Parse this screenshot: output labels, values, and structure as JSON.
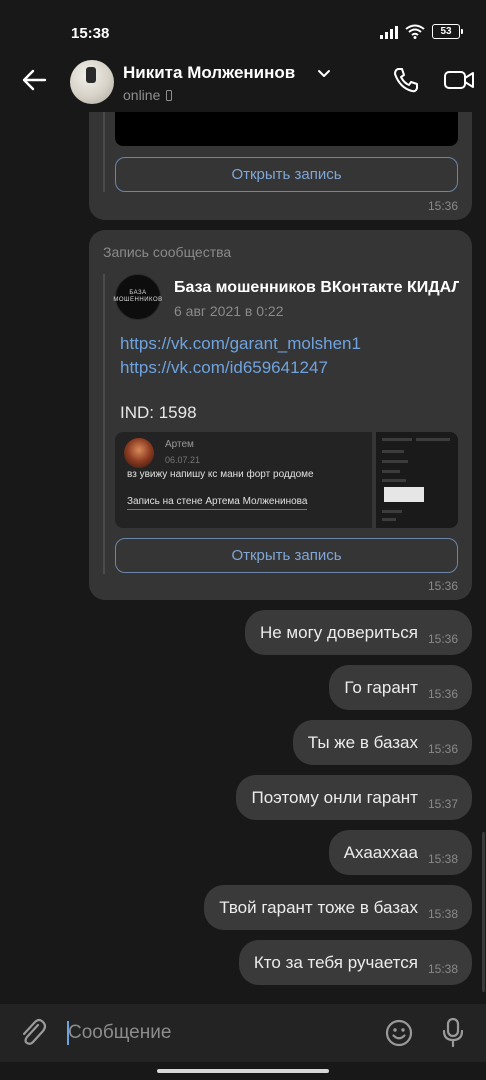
{
  "status_bar": {
    "time": "15:38",
    "battery": "53",
    "icons": [
      "signal-icon",
      "wifi-icon",
      "battery-icon"
    ]
  },
  "header": {
    "contact_name": "Никита Молженинов",
    "status": "online",
    "icons": [
      "back-arrow-icon",
      "chevron-down-icon",
      "phone-call-icon",
      "video-call-icon"
    ]
  },
  "messages": {
    "first_post": {
      "open_button": "Открыть запись",
      "time": "15:36"
    },
    "repost": {
      "label": "Запись сообщества",
      "community_avatar_text": "БАЗА МОШЕННИКОВ",
      "community_name": "База мошенников ВКонтакте  КИДАЛЫ",
      "date": "6 авг 2021 в 0:22",
      "link1": "https://vk.com/garant_molshen1",
      "link2": "https://vk.com/id659641247",
      "ind": "IND: 1598",
      "attachment": {
        "author": "Артем",
        "date": "06.07.21",
        "text": "вз увижу напишу кс мани форт роддоме",
        "record_link": "Запись на стене Артема Молженинова"
      },
      "open_button": "Открыть запись",
      "time": "15:36"
    },
    "outgoing": [
      {
        "text": "Не могу довериться",
        "time": "15:36"
      },
      {
        "text": "Го гарант",
        "time": "15:36"
      },
      {
        "text": "Ты же в базах",
        "time": "15:36"
      },
      {
        "text": "Поэтому онли гарант",
        "time": "15:37"
      },
      {
        "text": "Ахааххаа",
        "time": "15:38"
      },
      {
        "text": "Твой гарант тоже в базах",
        "time": "15:38"
      },
      {
        "text": "Кто за тебя ручается",
        "time": "15:38"
      }
    ]
  },
  "composer": {
    "placeholder": "Сообщение",
    "icons": [
      "paperclip-icon",
      "emoji-icon",
      "microphone-icon"
    ]
  },
  "colors": {
    "background": "#181818",
    "incoming_bubble": "#353535",
    "outgoing_bubble": "#3a3a3a",
    "link": "#6fa3df",
    "button_border": "#6b86a8"
  }
}
